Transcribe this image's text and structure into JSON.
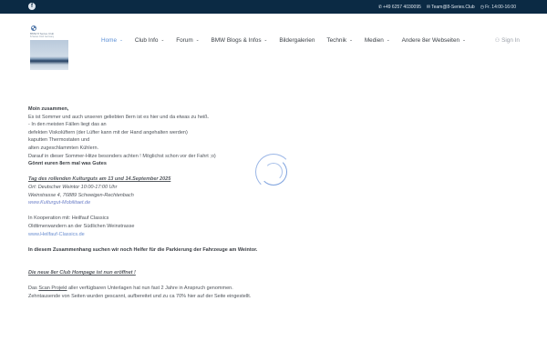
{
  "topbar": {
    "facebook_icon": "facebook-icon",
    "phone_icon": "phone-icon",
    "phone": "+49 6257 4030095",
    "email_icon": "envelope-icon",
    "email": "Team@8-Series.Club",
    "hours_icon": "clock-icon",
    "hours": "Fr. 14:00-16:00",
    "bg_color": "#0b2a44"
  },
  "logo": {
    "name": "BMW 8 Series Club",
    "subtitle": "8-Series Club Germany"
  },
  "nav": {
    "items": [
      {
        "label": "Home"
      },
      {
        "label": "Club Info"
      },
      {
        "label": "Forum"
      },
      {
        "label": "BMW Blogs & Infos"
      },
      {
        "label": "Bildergalerien"
      },
      {
        "label": "Technik"
      },
      {
        "label": "Medien"
      },
      {
        "label": "Andere 8er Webseiten"
      }
    ],
    "signin": "Sign In",
    "accent_color": "#5b8fd6"
  },
  "content": {
    "greeting": "Moin zusammen,",
    "lines": [
      "Es ist Sommer und auch unseren geliebten 8ern ist es hier und da etwas zu heiß.",
      "- In den meisten Fällen liegt das an",
      "  defekten Viskolüftern (der Lüfter kann mit der Hand angehalten werden)",
      "  kaputten Thermostaten und",
      "  alten zugeschlammten Kühlern.",
      "Darauf in dieser Sommer-Hitze besonders achten ! Möglichst schon vor der Fahrt ;o)"
    ],
    "bold_line": "Gönnt euren 8ern mal was Gutes",
    "event_title": "Tag des rollenden Kulturguts am 13 und 14.September 2025",
    "event_place": "Ort: Deutscher Weintor 10:00-17:00 Uhr",
    "event_address": "Weinstrasse 4, 76889 Schweigen-Rechtenbach",
    "event_link": "www.Kulturgut-Mobilitaet.de",
    "coop_1": "In Kooperation mit: Heilfauf Classics",
    "coop_2": "Oldtimerwandern an der Südlichen Weinstrasse",
    "coop_link": "www.Heilfauf-Classics.de",
    "helpers": "In diesem Zusammenhang suchen wir noch Helfer für die Parkierung der Fahrzeuge am Weintor.",
    "homepage_title": "Die neue 8er Club Hompage ist nun eröffnet !",
    "scan_prefix": "Das ",
    "scan_link": "Scan Projekt",
    "scan_suffix": " aller verfügbaren Unterlagen hat nun fast 2 Jahre in Anspruch genommen.",
    "scan_line_2": "Zehntausende von Seiten wurden gescannt, aufbereitet und zu ca 70% hier auf der Seite eingestellt."
  }
}
